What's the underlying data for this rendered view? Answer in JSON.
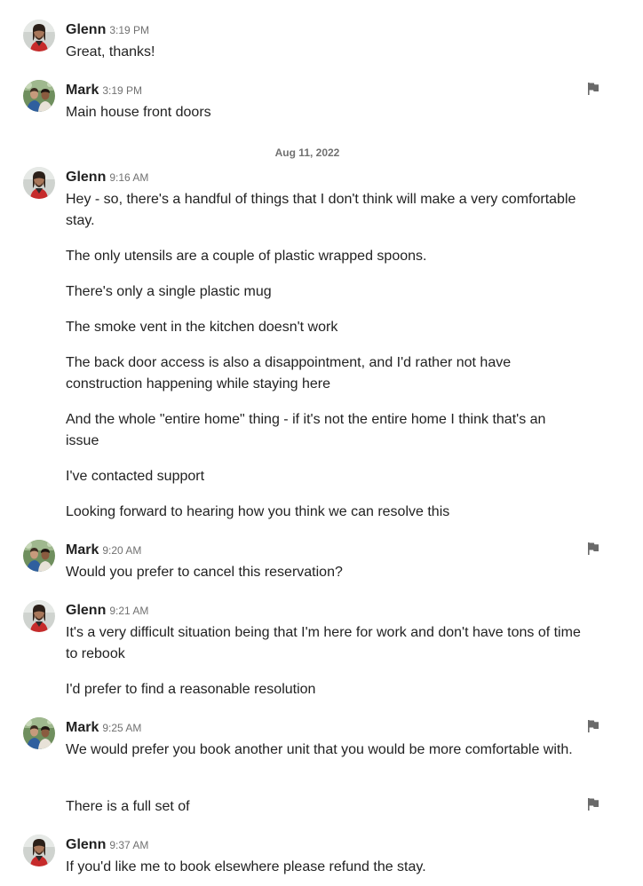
{
  "colors": {
    "text": "#222222",
    "muted": "#717171",
    "flag": "#6a6a6a"
  },
  "icons": {
    "report": "flag-icon"
  },
  "messages": [
    {
      "sender": "Glenn",
      "time": "3:19 PM",
      "texts": [
        "Great, thanks!"
      ]
    },
    {
      "sender": "Mark",
      "time": "3:19 PM",
      "texts": [
        "Main house front doors"
      ]
    },
    {
      "date_divider": "Aug 11, 2022"
    },
    {
      "sender": "Glenn",
      "time": "9:16 AM",
      "texts": [
        "Hey - so, there's a handful of things that I don't think will make a very comfortable stay.",
        "The only utensils are a couple of plastic wrapped spoons.",
        "There's only a single plastic mug",
        "The smoke vent in the kitchen doesn't work",
        "The back door access is also a disappointment, and I'd rather not have construction happening while staying here",
        "And the whole \"entire home\" thing - if it's not the entire home I think that's an issue",
        "I've contacted support",
        "Looking forward to hearing how you think we can resolve this"
      ]
    },
    {
      "sender": "Mark",
      "time": "9:20 AM",
      "texts": [
        "Would you prefer to cancel this reservation?"
      ]
    },
    {
      "sender": "Glenn",
      "time": "9:21 AM",
      "texts": [
        "It's a very difficult situation being that I'm here for work and don't have tons of time to rebook",
        "I'd prefer to find a reasonable resolution"
      ]
    },
    {
      "sender": "Mark",
      "time": "9:25 AM",
      "texts": [
        "We would prefer you book another unit that you would be more comfortable with.",
        "There is a full set of"
      ]
    },
    {
      "sender": "Glenn",
      "time": "9:37 AM",
      "texts": [
        "If you'd like me to book elsewhere please refund the stay."
      ]
    }
  ]
}
